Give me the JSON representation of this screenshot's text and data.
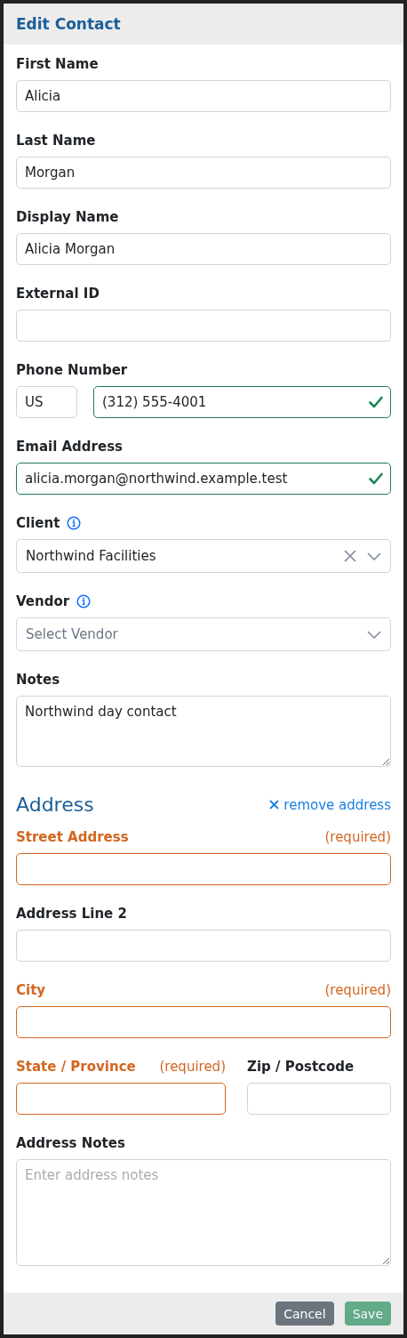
{
  "window": {
    "title": "Edit Contact"
  },
  "fields": [
    {
      "kind": "text",
      "label": "First Name",
      "value": "Alicia",
      "valid": false
    },
    {
      "kind": "text",
      "label": "Last Name",
      "value": "Morgan",
      "valid": false
    },
    {
      "kind": "text",
      "label": "Display Name",
      "value": "Alicia Morgan",
      "valid": false
    },
    {
      "kind": "text",
      "label": "External ID",
      "valid": false
    },
    {
      "kind": "phone",
      "label": "Phone Number",
      "country": "US",
      "value": "(312) 555-4001",
      "valid": true
    },
    {
      "kind": "text",
      "label": "Email Address",
      "value": "alicia.morgan@northwind.example.test",
      "valid": true
    },
    {
      "kind": "select",
      "label": "Client",
      "info": true,
      "value": "Northwind Facilities",
      "clearable": true
    },
    {
      "kind": "select",
      "label": "Vendor",
      "info": true,
      "placeholder": "Select Vendor"
    },
    {
      "kind": "textarea",
      "label": "Notes",
      "value": "Northwind day contact"
    }
  ],
  "address": {
    "title": "Address",
    "remove_link": "remove address",
    "fields": [
      {
        "kind": "text",
        "label": "Street Address",
        "required": true,
        "note": "(required)"
      },
      {
        "kind": "text",
        "label": "Address Line 2",
        "required": false
      },
      {
        "kind": "text",
        "label": "City",
        "required": true,
        "note": "(required)"
      },
      {
        "kind": "row",
        "fields": [
          {
            "kind": "text",
            "label": "State / Province",
            "required": true,
            "note": "(required)"
          },
          {
            "kind": "text",
            "label": "Zip / Postcode",
            "required": false
          }
        ]
      },
      {
        "kind": "textarea",
        "label": "Address Notes",
        "placeholder": "Enter address notes",
        "required": false
      }
    ]
  },
  "buttons": [
    {
      "label": "Cancel",
      "kind": "secondary",
      "disabled": false
    },
    {
      "label": "Save",
      "kind": "primary",
      "disabled": true
    }
  ]
}
